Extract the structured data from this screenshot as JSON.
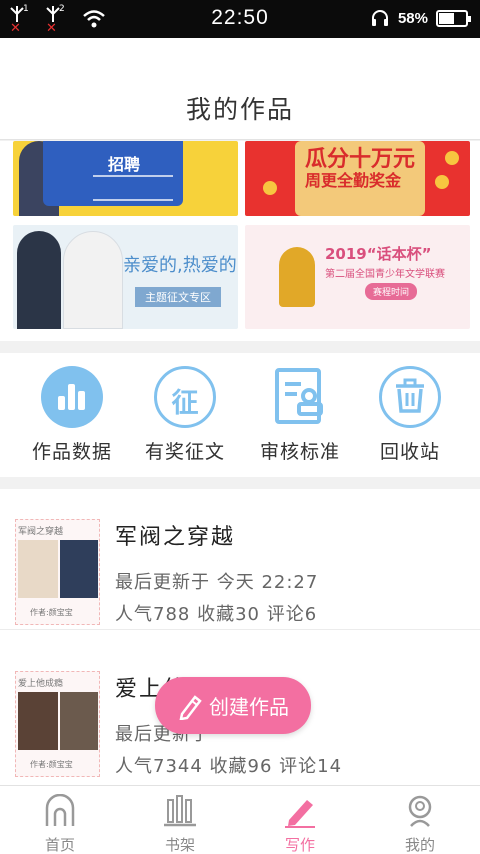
{
  "status_bar": {
    "sim1": "1",
    "sim2": "2",
    "time": "22:50",
    "battery": "58%",
    "battery_level": 0.58
  },
  "header": {
    "title": "我的作品"
  },
  "banners": [
    {
      "title": "招聘"
    },
    {
      "title": "瓜分十万元",
      "subtitle": "周更全勤奖金"
    },
    {
      "title": "亲爱的,热爱的",
      "subtitle": "主题征文专区"
    },
    {
      "title": "2019“话本杯”",
      "subtitle": "第二届全国青少年文学联赛",
      "tag": "赛程时间"
    }
  ],
  "functions": [
    {
      "label": "作品数据",
      "icon": "bar-chart-icon"
    },
    {
      "label": "有奖征文",
      "icon": "zheng-icon",
      "glyph": "征"
    },
    {
      "label": "审核标准",
      "icon": "review-document-icon"
    },
    {
      "label": "回收站",
      "icon": "trash-icon"
    }
  ],
  "works": [
    {
      "title": "军阀之穿越",
      "cover_text": "军阀之穿越",
      "cover_author": "作者:颜宝宝",
      "updated": "最后更新于 今天 22:27",
      "stats": "人气788 收藏30 评论6"
    },
    {
      "title": "爱上他成瘾",
      "cover_text": "爱上他成瘾",
      "cover_author": "作者:颜宝宝",
      "updated": "最后更新于",
      "stats": "人气7344 收藏96 评论14"
    }
  ],
  "fab": {
    "label": "创建作品"
  },
  "tabs": [
    {
      "label": "首页",
      "active": false
    },
    {
      "label": "书架",
      "active": false
    },
    {
      "label": "写作",
      "active": true
    },
    {
      "label": "我的",
      "active": false
    }
  ],
  "colors": {
    "accent": "#f36fa1",
    "icon_blue": "#80c1ee"
  }
}
